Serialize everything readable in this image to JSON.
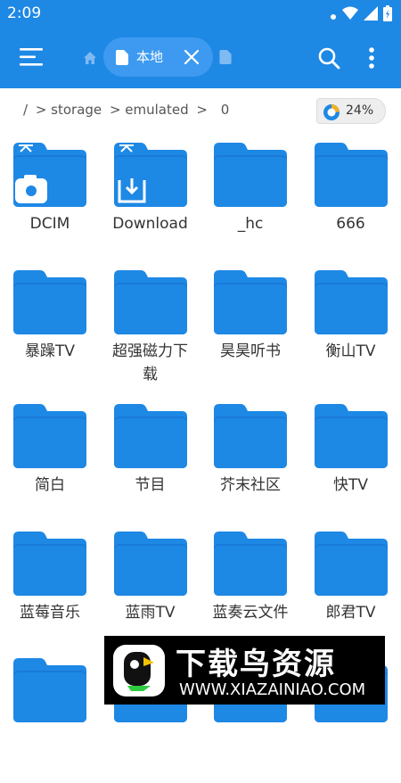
{
  "status_bar": {
    "time": "2:09"
  },
  "toolbar": {
    "tab_label": "本地"
  },
  "path": {
    "root": "/",
    "segments": [
      "> storage",
      "> emulated",
      ">",
      "0"
    ]
  },
  "storage": {
    "percent": "24%",
    "used_fraction": 0.24
  },
  "folders": [
    {
      "name": "DCIM",
      "badge": "camera"
    },
    {
      "name": "Download",
      "badge": "download"
    },
    {
      "name": "_hc",
      "badge": ""
    },
    {
      "name": "666",
      "badge": ""
    },
    {
      "name": "暴躁TV",
      "badge": ""
    },
    {
      "name": "超强磁力下载",
      "badge": ""
    },
    {
      "name": "昊昊听书",
      "badge": ""
    },
    {
      "name": "衡山TV",
      "badge": ""
    },
    {
      "name": "简白",
      "badge": ""
    },
    {
      "name": "节目",
      "badge": ""
    },
    {
      "name": "芥末社区",
      "badge": ""
    },
    {
      "name": "快TV",
      "badge": ""
    },
    {
      "name": "蓝莓音乐",
      "badge": ""
    },
    {
      "name": "蓝雨TV",
      "badge": ""
    },
    {
      "name": "蓝奏云文件",
      "badge": ""
    },
    {
      "name": "郎君TV",
      "badge": ""
    },
    {
      "name": "",
      "badge": ""
    },
    {
      "name": "",
      "badge": ""
    },
    {
      "name": "",
      "badge": ""
    },
    {
      "name": "",
      "badge": ""
    }
  ],
  "watermark": {
    "title": "下载鸟资源",
    "url": "WWW.XIAZAINIAO.COM"
  },
  "colors": {
    "accent": "#1e88e5",
    "folder": "#1e88e5",
    "folder_dark": "#1a7ad9"
  }
}
